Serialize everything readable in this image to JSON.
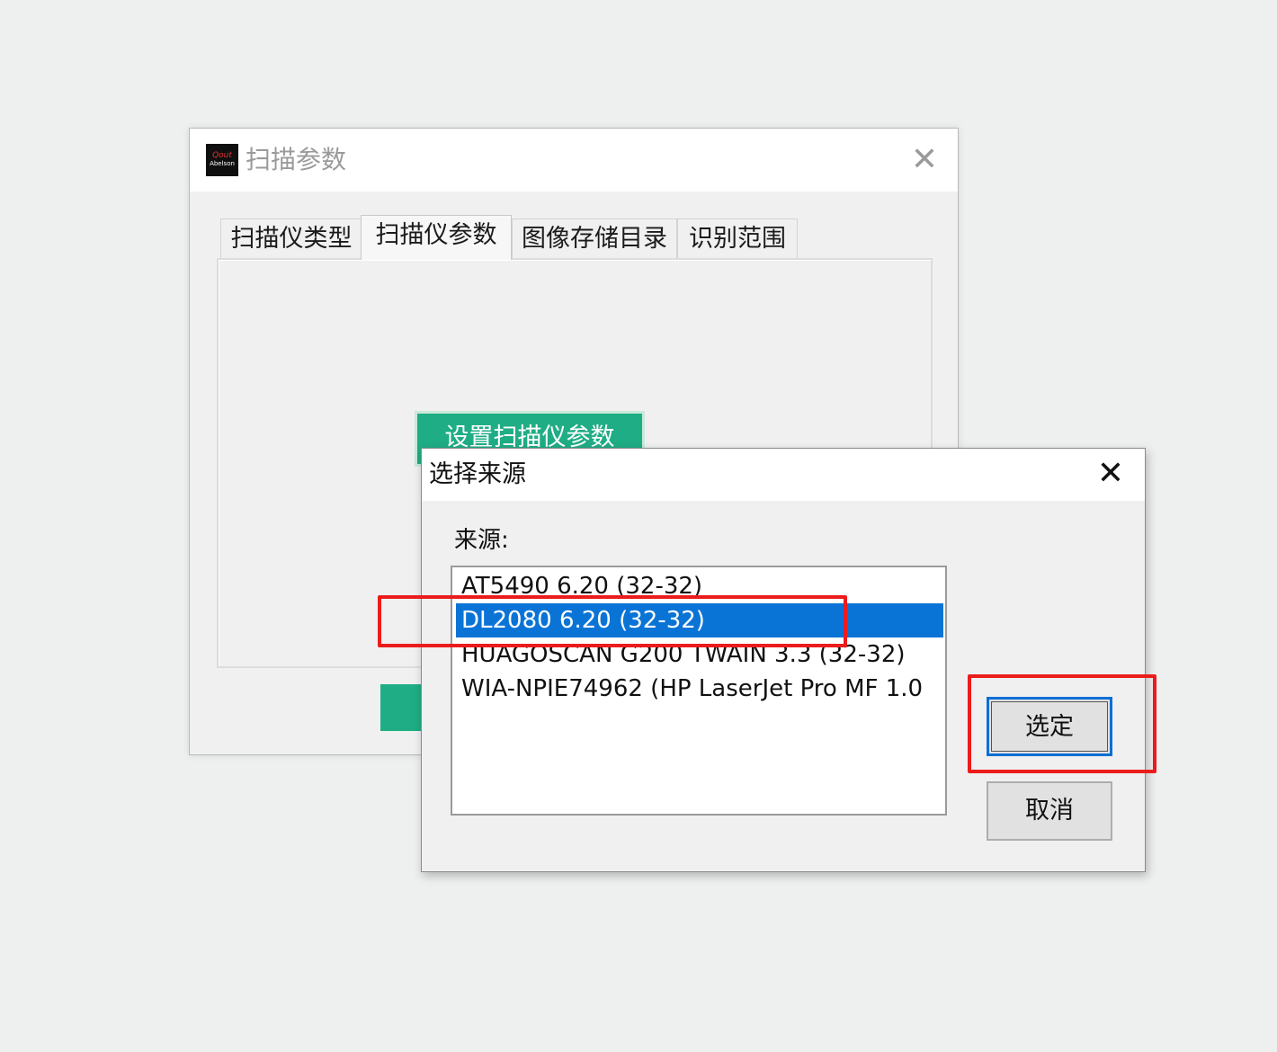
{
  "main_window": {
    "title": "扫描参数",
    "logo_text_top": "Qout",
    "logo_text_bottom": "Abelson",
    "close_glyph": "✕",
    "tabs": [
      {
        "label": "扫描仪类型"
      },
      {
        "label": "扫描仪参数"
      },
      {
        "label": "图像存储目录"
      },
      {
        "label": "识别范围"
      }
    ],
    "active_tab": "扫描仪参数",
    "set_params_button": "设置扫描仪参数",
    "accent_color": "#1fad85"
  },
  "dialog": {
    "title": "选择来源",
    "close_glyph": "✕",
    "source_label": "来源:",
    "sources": [
      {
        "label": "AT5490 6.20 (32-32)"
      },
      {
        "label": "DL2080 6.20 (32-32)"
      },
      {
        "label": "HUAGOSCAN G200 TWAIN 3.3 (32-32)"
      },
      {
        "label": "WIA-NPIE74962 (HP LaserJet Pro MF 1.0"
      }
    ],
    "selected_source": "DL2080 6.20 (32-32)",
    "ok_button": "选定",
    "cancel_button": "取消",
    "selection_color": "#0a74d6"
  },
  "annotations": {
    "highlight_color": "#ec1c1c"
  }
}
